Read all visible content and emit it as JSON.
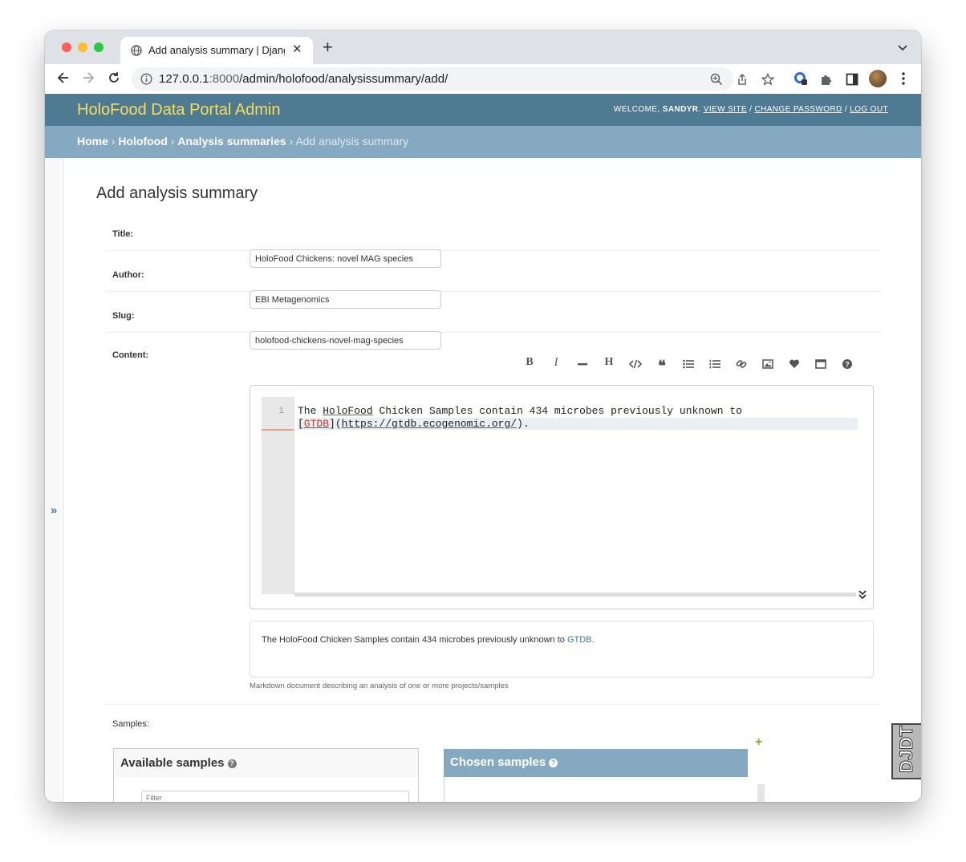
{
  "browser": {
    "tab_title": "Add analysis summary | Django site admin",
    "url_host": "127.0.0.1",
    "url_port": ":8000",
    "url_path": "/admin/holofood/analysissummary/add/"
  },
  "header": {
    "branding": "HoloFood Data Portal Admin",
    "welcome": "Welcome,",
    "username": "sandyr",
    "view_site": "View site",
    "change_password": "Change password",
    "log_out": "Log out",
    "slash": " / "
  },
  "breadcrumbs": {
    "home": "Home",
    "app": "Holofood",
    "model": "Analysis summaries",
    "current": "Add analysis summary",
    "sep": " › "
  },
  "sidebar": {
    "toggle": "»"
  },
  "page": {
    "title": "Add analysis summary"
  },
  "form": {
    "title_label": "Title:",
    "title_value": "HoloFood Chickens: novel MAG species",
    "author_label": "Author:",
    "author_value": "EBI Metagenomics",
    "slug_label": "Slug:",
    "slug_value": "holofood-chickens-novel-mag-species",
    "content_label": "Content:",
    "editor": {
      "line_number": "1",
      "line1_pre": "The ",
      "line1_word": "HoloFood",
      "line1_post": " Chicken Samples contain 434 microbes previously unknown to",
      "line2_open": "[",
      "line2_link_text": "GTDB",
      "line2_mid": "](",
      "line2_url": "https://gtdb.ecogenomic.org/",
      "line2_close": ")."
    },
    "preview_text": "The HoloFood Chicken Samples contain 434 microbes previously unknown to ",
    "preview_link": "GTDB",
    "preview_end": ".",
    "help_text": "Markdown document describing an analysis of one or more projects/samples",
    "samples_label": "Samples:",
    "available_title": "Available samples",
    "chosen_title": "Chosen samples",
    "filter_placeholder": "Filter",
    "add_symbol": "+"
  },
  "toolbar_buttons": [
    "bold",
    "italic",
    "horizontal-rule",
    "heading",
    "code",
    "quote",
    "unordered-list",
    "ordered-list",
    "link",
    "image",
    "heart",
    "fullscreen",
    "help"
  ],
  "djdt": {
    "label": "DJDT"
  },
  "colors": {
    "header_bg": "#4f7a94",
    "breadcrumb_bg": "#86a9c2",
    "branding": "#f5dd5d",
    "link": "#447e9b",
    "add_green": "#70bf2b"
  }
}
